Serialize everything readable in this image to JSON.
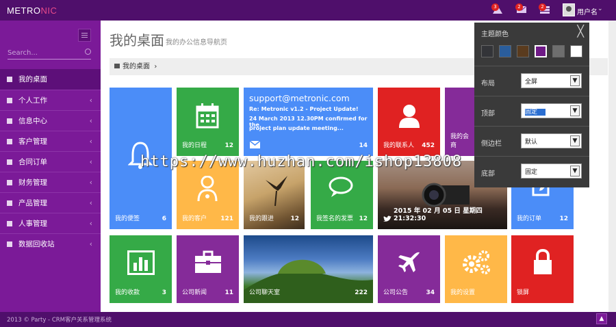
{
  "header": {
    "logo_a": "METRO",
    "logo_b": "NIC",
    "badges": [
      "3",
      "2",
      "2"
    ],
    "user_name": "用户名",
    "user_caret": "⌄"
  },
  "sidebar": {
    "search_placeholder": "Search...",
    "items": [
      {
        "label": "我的桌面",
        "icon": "home-icon"
      },
      {
        "label": "个人工作",
        "icon": "user-icon"
      },
      {
        "label": "信息中心",
        "icon": "mail-icon"
      },
      {
        "label": "客户管理",
        "icon": "person-icon"
      },
      {
        "label": "合同订单",
        "icon": "book-icon"
      },
      {
        "label": "财务管理",
        "icon": "yen-icon"
      },
      {
        "label": "产品管理",
        "icon": "table-icon"
      },
      {
        "label": "人事管理",
        "icon": "grid-icon"
      },
      {
        "label": "数据回收站",
        "icon": "trash-icon"
      }
    ],
    "chevron": "‹"
  },
  "page": {
    "title": "我的桌面",
    "subtitle": "我的办公信息导航页",
    "breadcrumb": "我的桌面",
    "breadcrumb_sep": "›"
  },
  "tiles": {
    "notes": {
      "label": "我的便签",
      "count": "6"
    },
    "calendar": {
      "label": "我的日程",
      "count": "12"
    },
    "mail": {
      "address": "support@metronic.com",
      "line1": "Re: Metronic v1.2 - Project Update!",
      "line2": "24 March 2013 12.30PM confirmed for the",
      "line3": "project plan update meeting...",
      "count": "14"
    },
    "contacts": {
      "label": "我的联系人",
      "count": "452"
    },
    "meeting": {
      "label": "我的会商"
    },
    "customers": {
      "label": "我的客户",
      "count": "121"
    },
    "tracking": {
      "label": "我的跟进",
      "count": "12"
    },
    "signed": {
      "label": "我签名的发票",
      "count": "12"
    },
    "twitter": {
      "text": "2015 年 02 月 05 日 星期四 21:32:30"
    },
    "orders": {
      "label": "我的订单",
      "count": "12"
    },
    "income": {
      "label": "我的收款",
      "count": "3"
    },
    "news": {
      "label": "公司新闻",
      "count": "11"
    },
    "chat": {
      "label": "公司聊天室",
      "count": "222"
    },
    "notice": {
      "label": "公司公告",
      "count": "34"
    },
    "settings": {
      "label": "我的设置"
    },
    "lock": {
      "label": "锁屏"
    }
  },
  "theme_panel": {
    "title": "主题颜色",
    "close": "╳",
    "colors": [
      "#333438",
      "#2a5d9c",
      "#5a3b1e",
      "#6f1a87",
      "#6e6e6e",
      "#ffffff"
    ],
    "rows": [
      {
        "label": "布局",
        "value": "全屏"
      },
      {
        "label": "顶部",
        "value": "固定"
      },
      {
        "label": "侧边栏",
        "value": "默认"
      },
      {
        "label": "底部",
        "value": "固定"
      }
    ],
    "dropdown_glyph": "▼"
  },
  "watermark": "https://www.huzhan.com/ishop13808",
  "footer": {
    "text": "2013 © Party - CRM客户关系管理系统",
    "up": "▲"
  }
}
